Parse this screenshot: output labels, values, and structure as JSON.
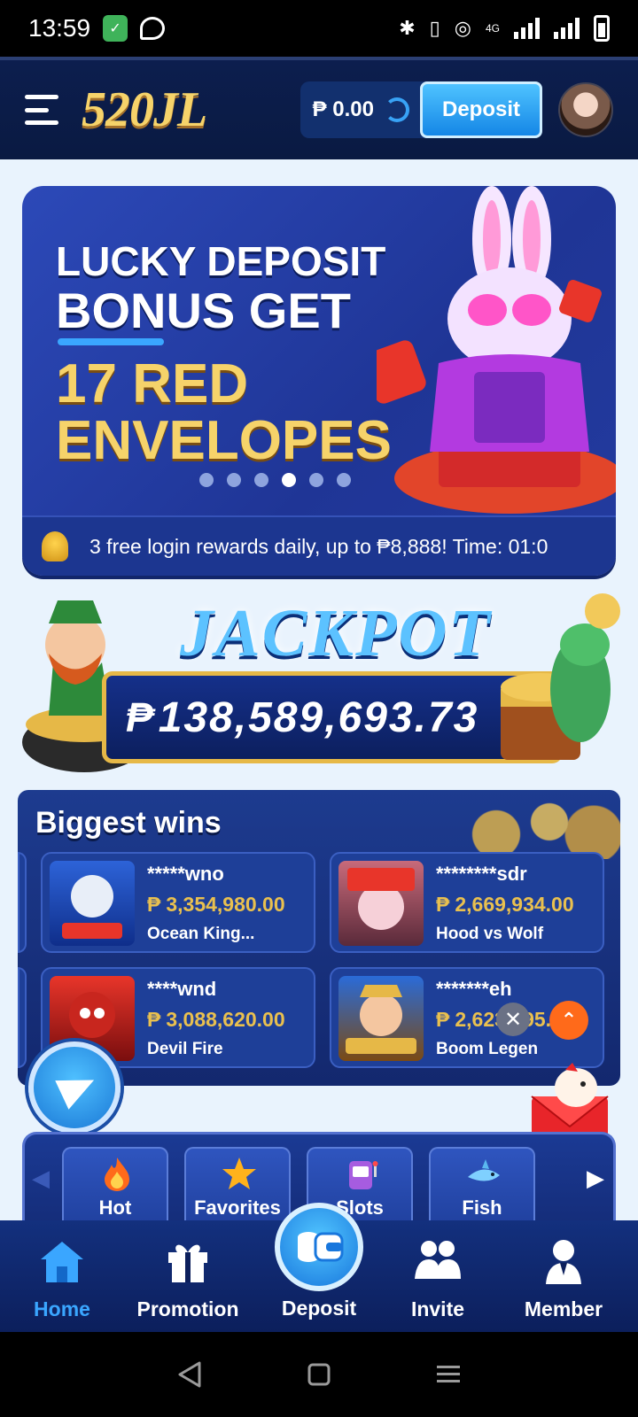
{
  "status": {
    "time": "13:59",
    "network": "4G"
  },
  "header": {
    "logo": "520JL",
    "balance": "₱ 0.00",
    "deposit_label": "Deposit"
  },
  "banner": {
    "line1": "LUCKY DEPOSIT",
    "line2": "BONUS GET",
    "line3": "17 RED",
    "line4": "ENVELOPES",
    "slides": 6,
    "active_slide": 4,
    "notice": "3 free login rewards daily, up to ₱8,888! Time: 01:0"
  },
  "jackpot": {
    "title": "JACKPOT",
    "currency": "₱",
    "amount": "138,589,693.73"
  },
  "wins": {
    "title": "Biggest wins",
    "items": [
      {
        "user": "*****wno",
        "currency": "₱",
        "amount": "3,354,980.00",
        "game": "Ocean King...",
        "thumb_color": "#2d63d8"
      },
      {
        "user": "********sdr",
        "currency": "₱",
        "amount": "2,669,934.00",
        "game": "Hood vs Wolf",
        "thumb_color": "#c86a7a"
      },
      {
        "user": "****wnd",
        "currency": "₱",
        "amount": "3,088,620.00",
        "game": "Devil Fire",
        "thumb_color": "#c8261e"
      },
      {
        "user": "*******eh",
        "currency": "₱",
        "amount": "2,623,395.00",
        "game": "Boom Legen",
        "thumb_color": "#b8862a"
      }
    ]
  },
  "categories": [
    {
      "label": "Hot",
      "icon": "fire-icon",
      "color": "#ff6a1a"
    },
    {
      "label": "Favorites",
      "icon": "star-icon",
      "color": "#ffb21c"
    },
    {
      "label": "Slots",
      "icon": "slot-machine-icon",
      "color": "#a65ce0"
    },
    {
      "label": "Fish",
      "icon": "shark-icon",
      "color": "#7fd0ff"
    }
  ],
  "bottom_nav": {
    "home": "Home",
    "promotion": "Promotion",
    "deposit": "Deposit",
    "invite": "Invite",
    "member": "Member"
  },
  "colors": {
    "accent": "#3aa6ff",
    "gold": "#e9c04f",
    "header_bg": "#0c1e4e"
  }
}
